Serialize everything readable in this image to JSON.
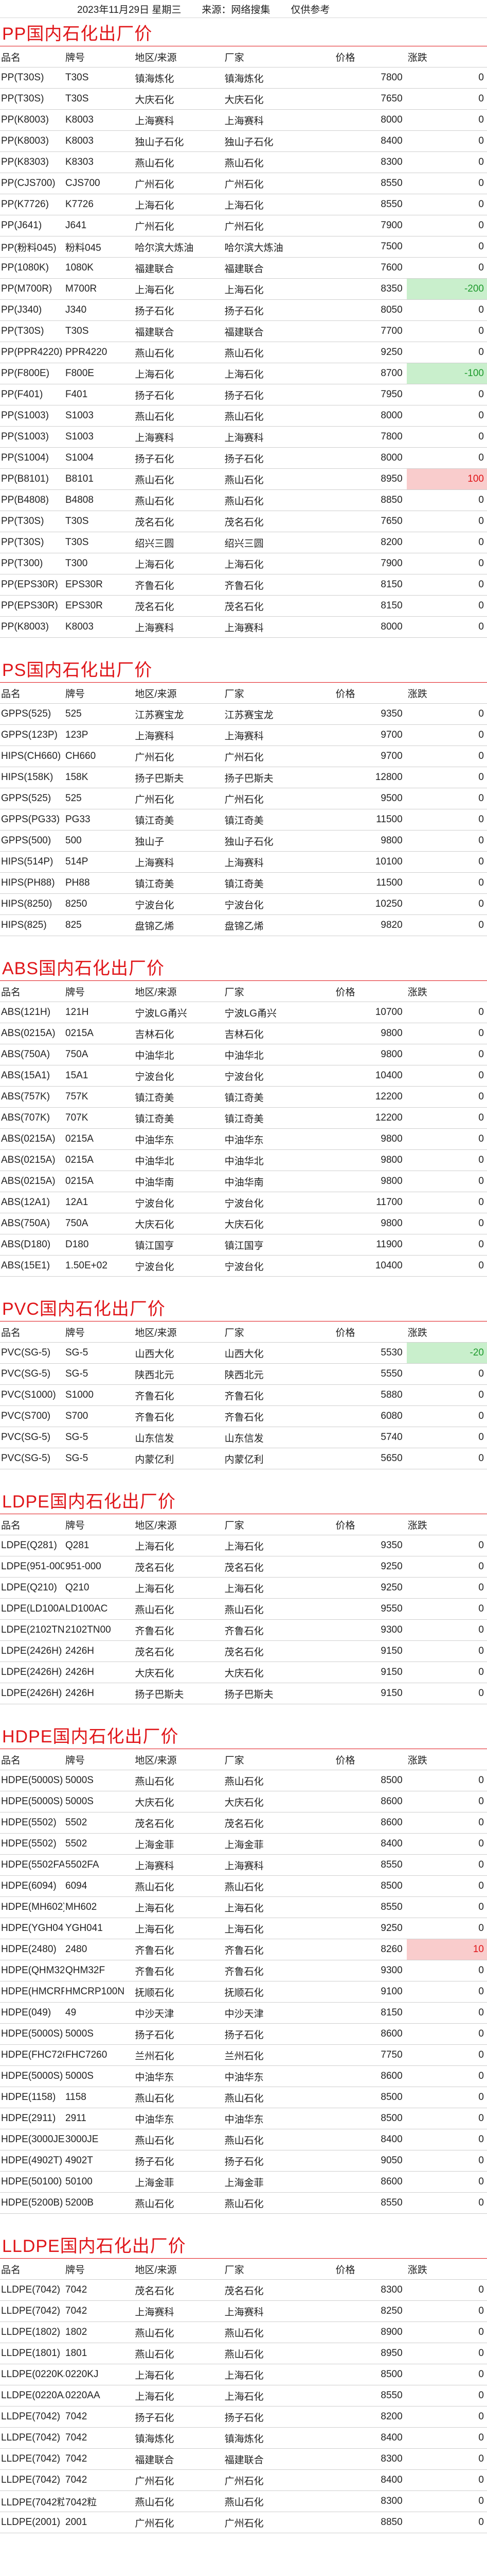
{
  "header": {
    "date": "2023年11月29日 星期三",
    "source": "来源：网络搜集",
    "note": "仅供参考"
  },
  "columns": [
    "品名",
    "牌号",
    "地区/来源",
    "厂家",
    "价格",
    "涨跌"
  ],
  "sections": [
    {
      "title": "PP国内石化出厂价",
      "rows": [
        [
          "PP(T30S)",
          "T30S",
          "镇海炼化",
          "镇海炼化",
          "7800",
          "0"
        ],
        [
          "PP(T30S)",
          "T30S",
          "大庆石化",
          "大庆石化",
          "7650",
          "0"
        ],
        [
          "PP(K8003)",
          "K8003",
          "上海赛科",
          "上海赛科",
          "8000",
          "0"
        ],
        [
          "PP(K8003)",
          "K8003",
          "独山子石化",
          "独山子石化",
          "8400",
          "0"
        ],
        [
          "PP(K8303)",
          "K8303",
          "燕山石化",
          "燕山石化",
          "8300",
          "0"
        ],
        [
          "PP(CJS700)",
          "CJS700",
          "广州石化",
          "广州石化",
          "8550",
          "0"
        ],
        [
          "PP(K7726)",
          "K7726",
          "上海石化",
          "上海石化",
          "8550",
          "0"
        ],
        [
          "PP(J641)",
          "J641",
          "广州石化",
          "广州石化",
          "7900",
          "0"
        ],
        [
          "PP(粉料045)",
          "粉料045",
          "哈尔滨大炼油",
          "哈尔滨大炼油",
          "7500",
          "0"
        ],
        [
          "PP(1080K)",
          "1080K",
          "福建联合",
          "福建联合",
          "7600",
          "0"
        ],
        [
          "PP(M700R)",
          "M700R",
          "上海石化",
          "上海石化",
          "8350",
          "-200"
        ],
        [
          "PP(J340)",
          "J340",
          "扬子石化",
          "扬子石化",
          "8050",
          "0"
        ],
        [
          "PP(T30S)",
          "T30S",
          "福建联合",
          "福建联合",
          "7700",
          "0"
        ],
        [
          "PP(PPR4220)",
          "PPR4220",
          "燕山石化",
          "燕山石化",
          "9250",
          "0"
        ],
        [
          "PP(F800E)",
          "F800E",
          "上海石化",
          "上海石化",
          "8700",
          "-100"
        ],
        [
          "PP(F401)",
          "F401",
          "扬子石化",
          "扬子石化",
          "7950",
          "0"
        ],
        [
          "PP(S1003)",
          "S1003",
          "燕山石化",
          "燕山石化",
          "8000",
          "0"
        ],
        [
          "PP(S1003)",
          "S1003",
          "上海赛科",
          "上海赛科",
          "7800",
          "0"
        ],
        [
          "PP(S1004)",
          "S1004",
          "扬子石化",
          "扬子石化",
          "8000",
          "0"
        ],
        [
          "PP(B8101)",
          "B8101",
          "燕山石化",
          "燕山石化",
          "8950",
          "100"
        ],
        [
          "PP(B4808)",
          "B4808",
          "燕山石化",
          "燕山石化",
          "8850",
          "0"
        ],
        [
          "PP(T30S)",
          "T30S",
          "茂名石化",
          "茂名石化",
          "7650",
          "0"
        ],
        [
          "PP(T30S)",
          "T30S",
          "绍兴三圆",
          "绍兴三圆",
          "8200",
          "0"
        ],
        [
          "PP(T300)",
          "T300",
          "上海石化",
          "上海石化",
          "7900",
          "0"
        ],
        [
          "PP(EPS30R)",
          "EPS30R",
          "齐鲁石化",
          "齐鲁石化",
          "8150",
          "0"
        ],
        [
          "PP(EPS30R)",
          "EPS30R",
          "茂名石化",
          "茂名石化",
          "8150",
          "0"
        ],
        [
          "PP(K8003)",
          "K8003",
          "上海赛科",
          "上海赛科",
          "8000",
          "0"
        ]
      ]
    },
    {
      "title": "PS国内石化出厂价",
      "rows": [
        [
          "GPPS(525)",
          "525",
          "江苏赛宝龙",
          "江苏赛宝龙",
          "9350",
          "0"
        ],
        [
          "GPPS(123P)",
          "123P",
          "上海赛科",
          "上海赛科",
          "9700",
          "0"
        ],
        [
          "HIPS(CH660)",
          "CH660",
          "广州石化",
          "广州石化",
          "9700",
          "0"
        ],
        [
          "HIPS(158K)",
          "158K",
          "扬子巴斯夫",
          "扬子巴斯夫",
          "12800",
          "0"
        ],
        [
          "GPPS(525)",
          "525",
          "广州石化",
          "广州石化",
          "9500",
          "0"
        ],
        [
          "GPPS(PG33)",
          "PG33",
          "镇江奇美",
          "镇江奇美",
          "11500",
          "0"
        ],
        [
          "GPPS(500)",
          "500",
          "独山子",
          "独山子石化",
          "9800",
          "0"
        ],
        [
          "HIPS(514P)",
          "514P",
          "上海赛科",
          "上海赛科",
          "10100",
          "0"
        ],
        [
          "HIPS(PH88)",
          "PH88",
          "镇江奇美",
          "镇江奇美",
          "11500",
          "0"
        ],
        [
          "HIPS(8250)",
          "8250",
          "宁波台化",
          "宁波台化",
          "10250",
          "0"
        ],
        [
          "HIPS(825)",
          "825",
          "盘锦乙烯",
          "盘锦乙烯",
          "9820",
          "0"
        ]
      ]
    },
    {
      "title": "ABS国内石化出厂价",
      "rows": [
        [
          "ABS(121H)",
          "121H",
          "宁波LG甬兴",
          "宁波LG甬兴",
          "10700",
          "0"
        ],
        [
          "ABS(0215A)",
          "0215A",
          "吉林石化",
          "吉林石化",
          "9800",
          "0"
        ],
        [
          "ABS(750A)",
          "750A",
          "中油华北",
          "中油华北",
          "9800",
          "0"
        ],
        [
          "ABS(15A1)",
          "15A1",
          "宁波台化",
          "宁波台化",
          "10400",
          "0"
        ],
        [
          "ABS(757K)",
          "757K",
          "镇江奇美",
          "镇江奇美",
          "12200",
          "0"
        ],
        [
          "ABS(707K)",
          "707K",
          "镇江奇美",
          "镇江奇美",
          "12200",
          "0"
        ],
        [
          "ABS(0215A)",
          "0215A",
          "中油华东",
          "中油华东",
          "9800",
          "0"
        ],
        [
          "ABS(0215A)",
          "0215A",
          "中油华北",
          "中油华北",
          "9800",
          "0"
        ],
        [
          "ABS(0215A)",
          "0215A",
          "中油华南",
          "中油华南",
          "9800",
          "0"
        ],
        [
          "ABS(12A1)",
          "12A1",
          "宁波台化",
          "宁波台化",
          "11700",
          "0"
        ],
        [
          "ABS(750A)",
          "750A",
          "大庆石化",
          "大庆石化",
          "9800",
          "0"
        ],
        [
          "ABS(D180)",
          "D180",
          "镇江国亨",
          "镇江国亨",
          "11900",
          "0"
        ],
        [
          "ABS(15E1)",
          "1.50E+02",
          "宁波台化",
          "宁波台化",
          "10400",
          "0"
        ]
      ]
    },
    {
      "title": "PVC国内石化出厂价",
      "rows": [
        [
          "PVC(SG-5)",
          "SG-5",
          "山西大化",
          "山西大化",
          "5530",
          "-20"
        ],
        [
          "PVC(SG-5)",
          "SG-5",
          "陕西北元",
          "陕西北元",
          "5550",
          "0"
        ],
        [
          "PVC(S1000)",
          "S1000",
          "齐鲁石化",
          "齐鲁石化",
          "5880",
          "0"
        ],
        [
          "PVC(S700)",
          "S700",
          "齐鲁石化",
          "齐鲁石化",
          "6080",
          "0"
        ],
        [
          "PVC(SG-5)",
          "SG-5",
          "山东信发",
          "山东信发",
          "5740",
          "0"
        ],
        [
          "PVC(SG-5)",
          "SG-5",
          "内蒙亿利",
          "内蒙亿利",
          "5650",
          "0"
        ]
      ]
    },
    {
      "title": "LDPE国内石化出厂价",
      "rows": [
        [
          "LDPE(Q281)",
          "Q281",
          "上海石化",
          "上海石化",
          "9350",
          "0"
        ],
        [
          "LDPE(951-000)",
          "951-000",
          "茂名石化",
          "茂名石化",
          "9250",
          "0"
        ],
        [
          "LDPE(Q210)",
          "Q210",
          "上海石化",
          "上海石化",
          "9250",
          "0"
        ],
        [
          "LDPE(LD100AC)",
          "LD100AC",
          "燕山石化",
          "燕山石化",
          "9550",
          "0"
        ],
        [
          "LDPE(2102TN00)",
          "2102TN00",
          "齐鲁石化",
          "齐鲁石化",
          "9300",
          "0"
        ],
        [
          "LDPE(2426H)",
          "2426H",
          "茂名石化",
          "茂名石化",
          "9150",
          "0"
        ],
        [
          "LDPE(2426H)",
          "2426H",
          "大庆石化",
          "大庆石化",
          "9150",
          "0"
        ],
        [
          "LDPE(2426H)",
          "2426H",
          "扬子巴斯夫",
          "扬子巴斯夫",
          "9150",
          "0"
        ]
      ]
    },
    {
      "title": "HDPE国内石化出厂价",
      "rows": [
        [
          "HDPE(5000S)",
          "5000S",
          "燕山石化",
          "燕山石化",
          "8500",
          "0"
        ],
        [
          "HDPE(5000S)",
          "5000S",
          "大庆石化",
          "大庆石化",
          "8600",
          "0"
        ],
        [
          "HDPE(5502)",
          "5502",
          "茂名石化",
          "茂名石化",
          "8600",
          "0"
        ],
        [
          "HDPE(5502)",
          "5502",
          "上海金菲",
          "上海金菲",
          "8400",
          "0"
        ],
        [
          "HDPE(5502FA)",
          "5502FA",
          "上海赛科",
          "上海赛科",
          "8550",
          "0"
        ],
        [
          "HDPE(6094)",
          "6094",
          "燕山石化",
          "燕山石化",
          "8500",
          "0"
        ],
        [
          "HDPE(MH602)",
          "MH602",
          "上海石化",
          "上海石化",
          "8550",
          "0"
        ],
        [
          "HDPE(YGH041)",
          "YGH041",
          "上海石化",
          "上海石化",
          "9250",
          "0"
        ],
        [
          "HDPE(2480)",
          "2480",
          "齐鲁石化",
          "齐鲁石化",
          "8260",
          "10"
        ],
        [
          "HDPE(QHM32F)",
          "QHM32F",
          "齐鲁石化",
          "齐鲁石化",
          "9300",
          "0"
        ],
        [
          "HDPE(HMCRP100N)",
          "HMCRP100N",
          "抚顺石化",
          "抚顺石化",
          "9100",
          "0"
        ],
        [
          "HDPE(049)",
          "49",
          "中沙天津",
          "中沙天津",
          "8150",
          "0"
        ],
        [
          "HDPE(5000S)",
          "5000S",
          "扬子石化",
          "扬子石化",
          "8600",
          "0"
        ],
        [
          "HDPE(FHC7260)",
          "FHC7260",
          "兰州石化",
          "兰州石化",
          "7750",
          "0"
        ],
        [
          "HDPE(5000S)",
          "5000S",
          "中油华东",
          "中油华东",
          "8600",
          "0"
        ],
        [
          "HDPE(1158)",
          "1158",
          "燕山石化",
          "燕山石化",
          "8500",
          "0"
        ],
        [
          "HDPE(2911)",
          "2911",
          "中油华东",
          "中油华东",
          "8500",
          "0"
        ],
        [
          "HDPE(3000JE)",
          "3000JE",
          "燕山石化",
          "燕山石化",
          "8400",
          "0"
        ],
        [
          "HDPE(4902T)",
          "4902T",
          "扬子石化",
          "扬子石化",
          "9050",
          "0"
        ],
        [
          "HDPE(50100)",
          "50100",
          "上海金菲",
          "上海金菲",
          "8600",
          "0"
        ],
        [
          "HDPE(5200B)",
          "5200B",
          "燕山石化",
          "燕山石化",
          "8550",
          "0"
        ]
      ]
    },
    {
      "title": "LLDPE国内石化出厂价",
      "rows": [
        [
          "LLDPE(7042)",
          "7042",
          "茂名石化",
          "茂名石化",
          "8300",
          "0"
        ],
        [
          "LLDPE(7042)",
          "7042",
          "上海赛科",
          "上海赛科",
          "8250",
          "0"
        ],
        [
          "LLDPE(1802)",
          "1802",
          "燕山石化",
          "燕山石化",
          "8900",
          "0"
        ],
        [
          "LLDPE(1801)",
          "1801",
          "燕山石化",
          "燕山石化",
          "8950",
          "0"
        ],
        [
          "LLDPE(0220KJ)",
          "0220KJ",
          "上海石化",
          "上海石化",
          "8500",
          "0"
        ],
        [
          "LLDPE(0220AA)",
          "0220AA",
          "上海石化",
          "上海石化",
          "8550",
          "0"
        ],
        [
          "LLDPE(7042)",
          "7042",
          "扬子石化",
          "扬子石化",
          "8200",
          "0"
        ],
        [
          "LLDPE(7042)",
          "7042",
          "镇海炼化",
          "镇海炼化",
          "8400",
          "0"
        ],
        [
          "LLDPE(7042)",
          "7042",
          "福建联合",
          "福建联合",
          "8300",
          "0"
        ],
        [
          "LLDPE(7042)",
          "7042",
          "广州石化",
          "广州石化",
          "8400",
          "0"
        ],
        [
          "LLDPE(7042粒)",
          "7042粒",
          "燕山石化",
          "燕山石化",
          "8300",
          "0"
        ],
        [
          "LLDPE(2001)",
          "2001",
          "广州石化",
          "广州石化",
          "8850",
          "0"
        ]
      ]
    }
  ]
}
